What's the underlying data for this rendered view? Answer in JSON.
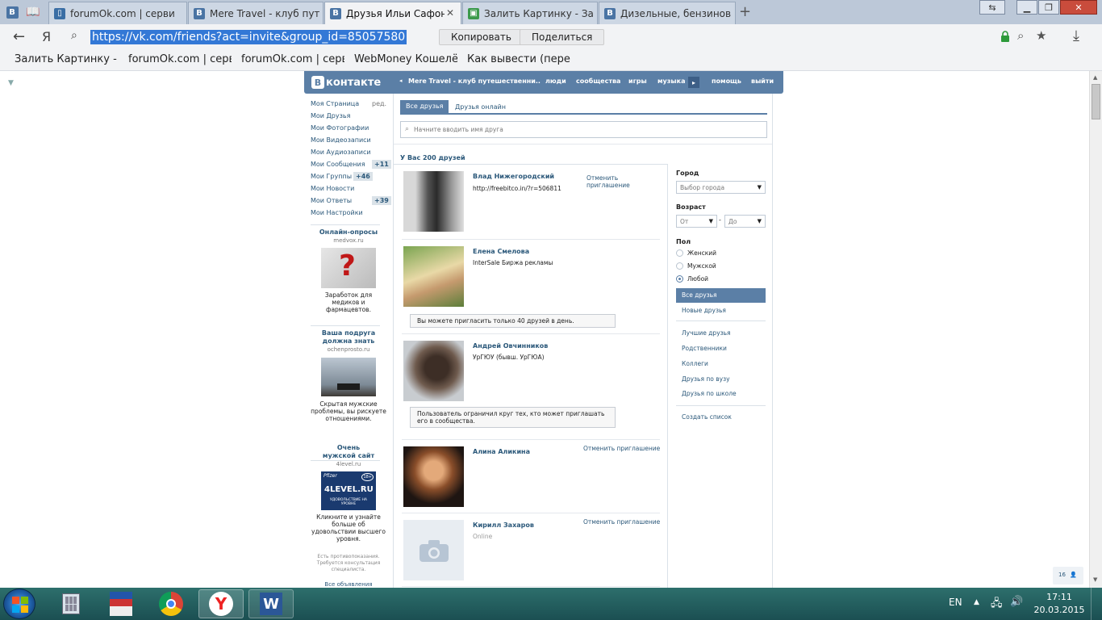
{
  "browser": {
    "tabs": [
      {
        "label": "forumOk.com | серви"
      },
      {
        "label": "Mere Travel - клуб пут"
      },
      {
        "label": "Друзья Ильи Сафоно"
      },
      {
        "label": "Залить Картинку - За"
      },
      {
        "label": "Дизельные, бензинов"
      }
    ],
    "new_tab": "+",
    "tab_close": "✕",
    "url": "https://vk.com/friends?act=invite&group_id=85057580",
    "yandex_letter": "Я",
    "copy_btn": "Копировать",
    "share_btn": "Поделиться",
    "bookmarks": [
      "Залить Картинку - З",
      "forumOk.com | серв",
      "forumOk.com | серв",
      "WebMoney Кошелё",
      "Как вывести (перев"
    ]
  },
  "vk": {
    "logo_b": "В",
    "logo_text": "контакте",
    "group_link": "Mere Travel - клуб путешественни..",
    "nav": [
      "люди",
      "сообщества",
      "игры",
      "музыка",
      "помощь",
      "выйти"
    ],
    "menu": [
      {
        "label": "Моя Страница",
        "extra": "ред."
      },
      {
        "label": "Мои Друзья"
      },
      {
        "label": "Мои Фотографии"
      },
      {
        "label": "Мои Видеозаписи"
      },
      {
        "label": "Мои Аудиозаписи"
      },
      {
        "label": "Мои Сообщения",
        "count": "+11"
      },
      {
        "label": "Мои Группы",
        "count": "+46"
      },
      {
        "label": "Мои Новости"
      },
      {
        "label": "Мои Ответы",
        "count": "+39"
      },
      {
        "label": "Мои Настройки"
      }
    ],
    "ads": [
      {
        "title": "Онлайн-опросы",
        "site": "medvox.ru",
        "text": "Заработок для медиков и фармацевтов."
      },
      {
        "title": "Ваша подруга должна знать",
        "site": "ochenprosto.ru",
        "text": "Скрытая мужские проблемы, вы рискуете отношениями."
      },
      {
        "title": "Очень мужской сайт",
        "site": "4level.ru",
        "text": "Кликните и узнайте больше об удовольствии высшего уровня.",
        "banner_brand": "Pfizer",
        "banner_main": "4LEVEL.RU",
        "banner_age": "18+",
        "banner_sub": "УДОВОЛЬСТВИЕ НА УРОВНЕ"
      }
    ],
    "disclaimer": "Есть противопоказания. Требуется консультация специалиста.",
    "all_ads": "Все объявления",
    "tabs": {
      "all": "Все друзья",
      "online": "Друзья онлайн"
    },
    "search_placeholder": "Начните вводить имя друга",
    "count_text": "У Вас 200 друзей",
    "friends": [
      {
        "name": "Влад Нижегородский",
        "sub": "http://freebitco.in/?r=506811",
        "action": "Отменить приглашение"
      },
      {
        "name": "Елена Смелова",
        "sub": "InterSale Биржа рекламы",
        "notice": "Вы можете пригласить только 40 друзей в день."
      },
      {
        "name": "Андрей Овчинников",
        "sub": "УрГЮУ (бывш. УрГЮА)",
        "notice": "Пользователь ограничил круг тех, кто может приглашать его в сообщества."
      },
      {
        "name": "Алина Аликина",
        "action": "Отменить приглашение"
      },
      {
        "name": "Кирилл Захаров",
        "sub": "Online",
        "action": "Отменить приглашение"
      }
    ],
    "filters": {
      "city_label": "Город",
      "city_value": "Выбор города",
      "age_label": "Возраст",
      "age_from": "От",
      "age_dash": "-",
      "age_to": "До",
      "sex_label": "Пол",
      "sex_options": [
        "Женский",
        "Мужской",
        "Любой"
      ],
      "sex_selected": "Любой",
      "lists": [
        "Все друзья",
        "Новые друзья",
        "Лучшие друзья",
        "Родственники",
        "Коллеги",
        "Друзья по вузу",
        "Друзья по школе",
        "Создать список"
      ]
    },
    "online_counter": "16"
  },
  "taskbar": {
    "lang": "EN",
    "time": "17:11",
    "date": "20.03.2015"
  },
  "colors": {
    "vk_blue": "#5b7fa6",
    "link": "#2b587a",
    "taskbar": "#1b4f52"
  }
}
